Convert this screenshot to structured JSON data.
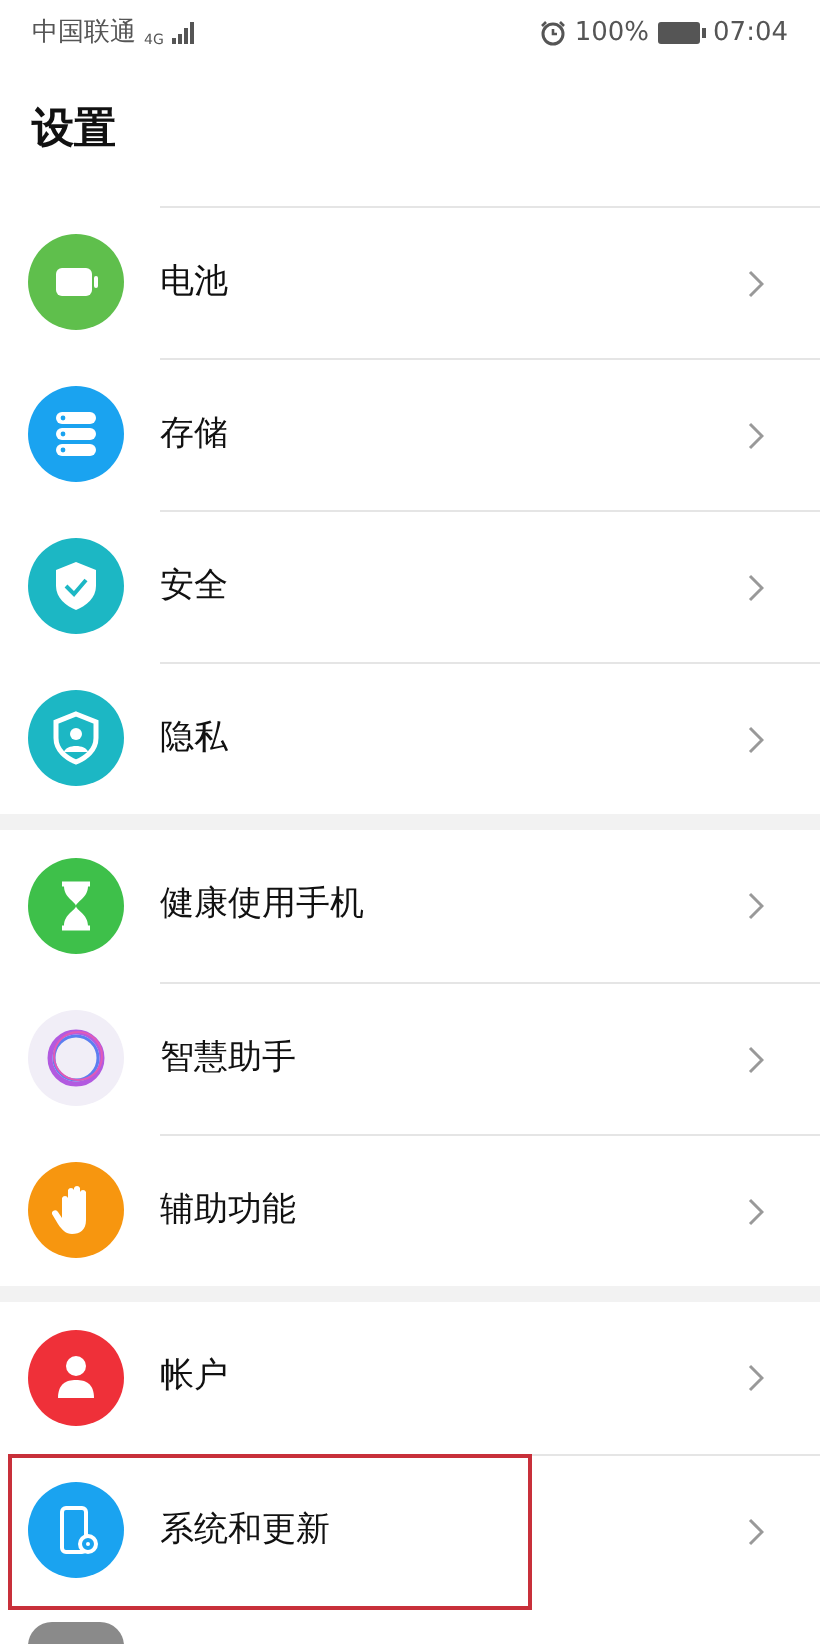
{
  "status_bar": {
    "carrier": "中国联通",
    "network": "4G",
    "battery": "100%",
    "time": "07:04"
  },
  "title": "设置",
  "groups": [
    {
      "items": [
        {
          "kind": "battery",
          "label": "电池",
          "highlighted": false
        },
        {
          "kind": "storage",
          "label": "存储",
          "highlighted": false
        },
        {
          "kind": "security",
          "label": "安全",
          "highlighted": false
        },
        {
          "kind": "privacy",
          "label": "隐私",
          "highlighted": false
        }
      ]
    },
    {
      "items": [
        {
          "kind": "health",
          "label": "健康使用手机",
          "highlighted": false
        },
        {
          "kind": "assistant",
          "label": "智慧助手",
          "highlighted": false
        },
        {
          "kind": "accessibility",
          "label": "辅助功能",
          "highlighted": false
        }
      ]
    },
    {
      "items": [
        {
          "kind": "account",
          "label": "帐户",
          "highlighted": false
        },
        {
          "kind": "system",
          "label": "系统和更新",
          "highlighted": true
        }
      ]
    }
  ]
}
